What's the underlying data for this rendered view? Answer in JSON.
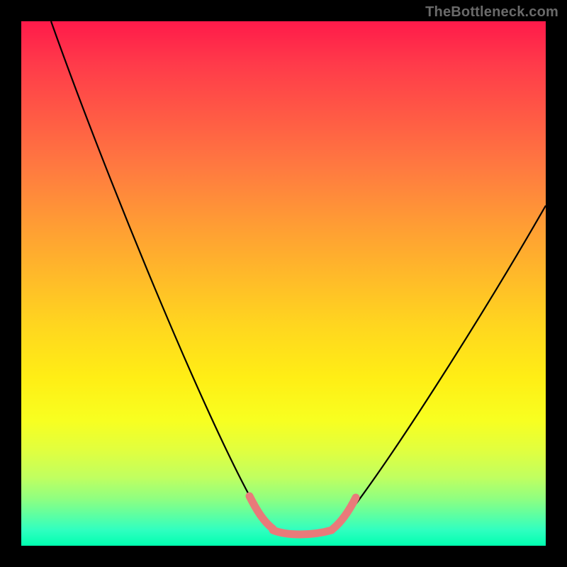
{
  "watermark": "TheBottleneck.com",
  "chart_data": {
    "type": "line",
    "title": "",
    "xlabel": "",
    "ylabel": "",
    "xlim": [
      0,
      100
    ],
    "ylim": [
      0,
      100
    ],
    "series": [
      {
        "name": "curve",
        "x": [
          6,
          15,
          25,
          35,
          45,
          48,
          50,
          53,
          55,
          58,
          60,
          63,
          70,
          80,
          90,
          100
        ],
        "y": [
          100,
          78,
          54,
          32,
          12,
          6,
          3,
          2,
          2,
          2,
          3,
          6,
          18,
          36,
          54,
          65
        ]
      },
      {
        "name": "highlight-region",
        "x": [
          44,
          47,
          50,
          53,
          56,
          59,
          62,
          64
        ],
        "y": [
          9,
          5,
          3,
          2,
          2,
          3,
          5,
          9
        ]
      }
    ],
    "background_gradient": {
      "orientation": "vertical",
      "stops": [
        {
          "pos": 0.0,
          "color": "#ff1a4a"
        },
        {
          "pos": 0.3,
          "color": "#ff8a38"
        },
        {
          "pos": 0.6,
          "color": "#ffe018"
        },
        {
          "pos": 0.85,
          "color": "#c0ff60"
        },
        {
          "pos": 1.0,
          "color": "#00ffb0"
        }
      ]
    },
    "highlight_color": "#e97a7a",
    "curve_color": "#000000"
  }
}
